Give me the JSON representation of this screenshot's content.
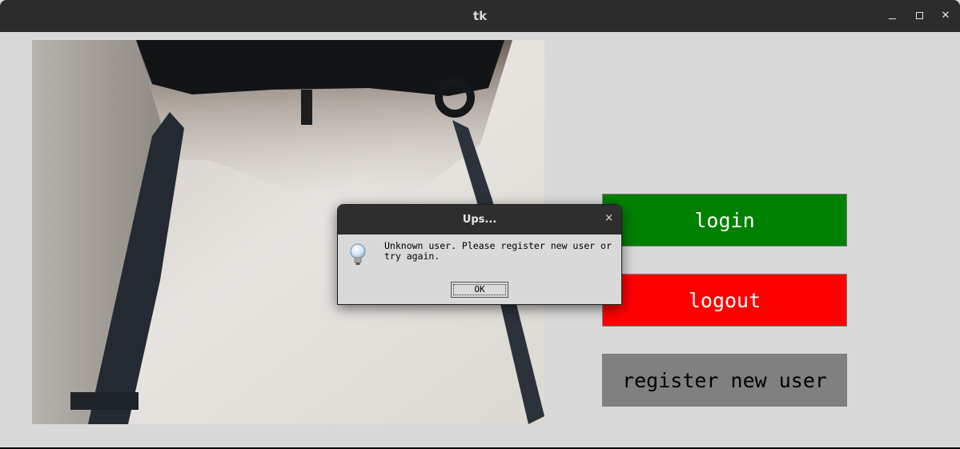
{
  "window": {
    "title": "tk"
  },
  "camera": {
    "icon": "webcam-feed"
  },
  "buttons": {
    "login": "login",
    "logout": "logout",
    "register": "register new user"
  },
  "dialog": {
    "title": "Ups...",
    "message": "Unknown user. Please register new user or try again.",
    "ok_label": "OK",
    "close_icon": "×"
  },
  "colors": {
    "login_bg": "#008000",
    "logout_bg": "#ff0000",
    "register_bg": "#808080",
    "window_bg": "#d9d9d9",
    "titlebar_bg": "#2c2c2c"
  }
}
